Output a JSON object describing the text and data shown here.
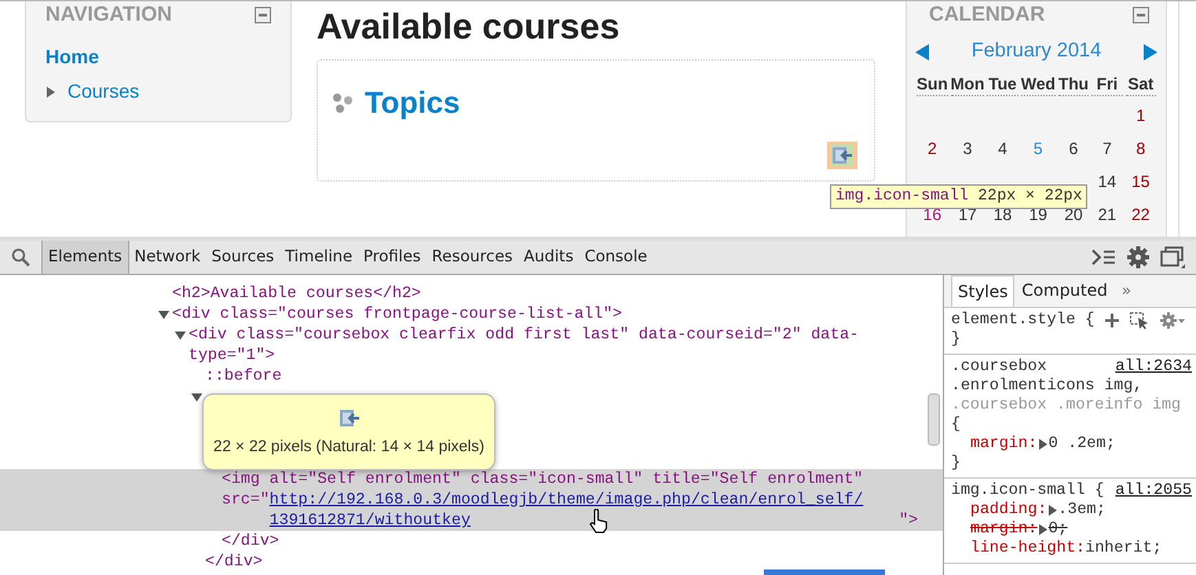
{
  "page": {
    "navigation": {
      "title": "NAVIGATION",
      "items": [
        {
          "label": "Home",
          "kind": "current"
        },
        {
          "label": "Courses",
          "kind": "branch",
          "expanded": false
        }
      ]
    },
    "heading": "Available courses",
    "course": {
      "title": "Topics",
      "enrol_icon_highlighted": true
    },
    "highlight_tooltip": {
      "selector": "img.icon-small",
      "size": "22px × 22px"
    },
    "calendar": {
      "title": "CALENDAR",
      "month": "February 2014",
      "weekdays": [
        "Sun",
        "Mon",
        "Tue",
        "Wed",
        "Thu",
        "Fri",
        "Sat"
      ],
      "weeks": [
        [
          {
            "kind": "blank"
          },
          {
            "kind": "blank"
          },
          {
            "kind": "blank"
          },
          {
            "kind": "blank"
          },
          {
            "kind": "blank"
          },
          {
            "kind": "blank"
          },
          {
            "kind": "day",
            "day": "1",
            "color": "#a00000"
          }
        ],
        [
          {
            "kind": "day",
            "day": "2",
            "color": "#a00000"
          },
          {
            "kind": "day",
            "day": "3",
            "color": "#333333"
          },
          {
            "kind": "day",
            "day": "4",
            "color": "#333333"
          },
          {
            "kind": "day",
            "day": "5",
            "color": "#2a8ad4"
          },
          {
            "kind": "day",
            "day": "6",
            "color": "#333333"
          },
          {
            "kind": "day",
            "day": "7",
            "color": "#333333"
          },
          {
            "kind": "day",
            "day": "8",
            "color": "#a00000"
          }
        ],
        [
          {
            "kind": "blank"
          },
          {
            "kind": "blank"
          },
          {
            "kind": "blank"
          },
          {
            "kind": "blank"
          },
          {
            "kind": "blank"
          },
          {
            "kind": "day",
            "day": "14",
            "color": "#333333"
          },
          {
            "kind": "day",
            "day": "15",
            "color": "#a00000"
          }
        ],
        [
          {
            "kind": "day",
            "day": "16",
            "color": "#a0207a"
          },
          {
            "kind": "day",
            "day": "17",
            "color": "#333333"
          },
          {
            "kind": "day",
            "day": "18",
            "color": "#333333"
          },
          {
            "kind": "day",
            "day": "19",
            "color": "#333333"
          },
          {
            "kind": "day",
            "day": "20",
            "color": "#333333"
          },
          {
            "kind": "day",
            "day": "21",
            "color": "#333333"
          },
          {
            "kind": "day",
            "day": "22",
            "color": "#a00000"
          }
        ]
      ]
    }
  },
  "devtools": {
    "tabs": [
      {
        "label": "Elements",
        "selected": true
      },
      {
        "label": "Network",
        "selected": false
      },
      {
        "label": "Sources",
        "selected": false
      },
      {
        "label": "Timeline",
        "selected": false
      },
      {
        "label": "Profiles",
        "selected": false
      },
      {
        "label": "Resources",
        "selected": false
      },
      {
        "label": "Audits",
        "selected": false
      },
      {
        "label": "Console",
        "selected": false
      }
    ],
    "elements": [
      {
        "text": "<h2>Available courses</h2>"
      },
      {
        "text": "<div class=\"courses frontpage-course-list-all\">",
        "expanded": true,
        "children": [
          {
            "text": "<div class=\"coursebox clearfix odd first last\" data-courseid=\"2\" data-type=\"1\">",
            "expanded": true,
            "children": [
              {
                "text": "::before"
              },
              {
                "expanded": true,
                "closing": "</div>",
                "children": [
                  {
                    "text": "<img alt=\"Self enrolment\" class=\"icon-small\" title=\"Self enrolment\"",
                    "attr": "src=\"",
                    "link": "http://192.168.0.3/moodlegjb/theme/image.php/clean/enrol_self/1391612871/withoutkey",
                    "after": "\">",
                    "selected": true
                  },
                  {
                    "text": "</div>"
                  }
                ]
              }
            ]
          }
        ]
      }
    ],
    "image_tooltip": "22 × 22 pixels (Natural: 14 × 14 pixels)",
    "styles": {
      "tabs": [
        {
          "label": "Styles",
          "selected": true
        },
        {
          "label": "Computed",
          "selected": false
        }
      ],
      "more": "»",
      "rules": [
        {
          "kind": "inline",
          "selectors": [
            {
              "text": "element.style",
              "matched": true
            }
          ],
          "open": "{",
          "close": "}"
        },
        {
          "kind": "rule",
          "source": "all:2634",
          "selectors": [
            {
              "text": ".coursebox",
              "matched": true
            },
            {
              "text": ".enrolmenticons img,",
              "matched": true
            },
            {
              "text": ".coursebox .moreinfo img",
              "matched": false
            }
          ],
          "open": "{",
          "close": "}",
          "properties": [
            {
              "name": "margin:",
              "value": "0 .2em;",
              "expandable": true,
              "overridden": false
            }
          ]
        },
        {
          "kind": "rule",
          "source": "all:2055",
          "selectors": [
            {
              "text": "img.icon-small",
              "matched": true
            }
          ],
          "open": "{",
          "properties": [
            {
              "name": "padding:",
              "value": ".3em;",
              "expandable": true,
              "overridden": false
            },
            {
              "name": "margin:",
              "value": "0;",
              "expandable": true,
              "overridden": true
            },
            {
              "name": "line-height:",
              "value": "inherit;",
              "expandable": false,
              "overridden": false
            }
          ]
        }
      ]
    }
  }
}
